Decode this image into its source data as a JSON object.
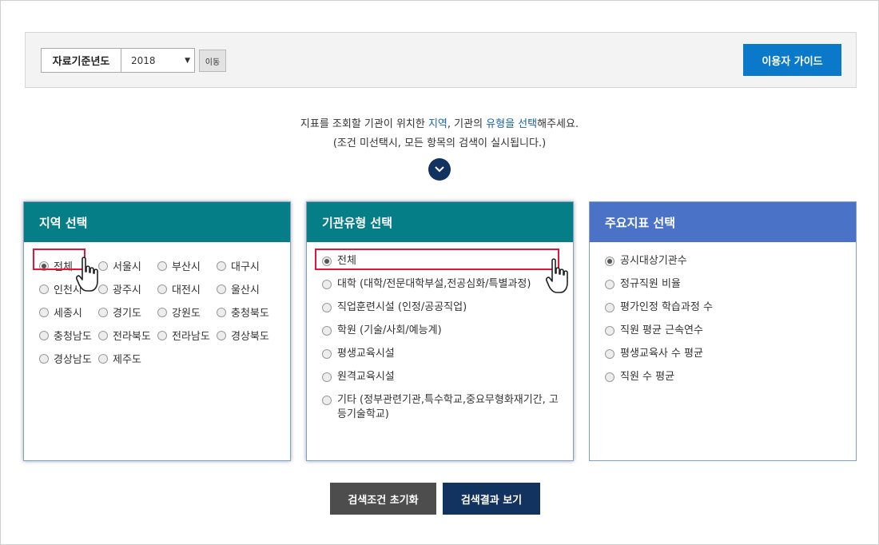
{
  "filter_bar": {
    "year_label": "자료기준년도",
    "year_value": "2018",
    "move_button": "이동",
    "guide_button": "이용자 가이드"
  },
  "instructions": {
    "line1_pre": "지표를 조회할 기관이 위치한 ",
    "line1_hl1": "지역",
    "line1_mid": ", 기관의 ",
    "line1_hl2": "유형을 선택",
    "line1_post": "해주세요.",
    "line2": "(조건 미선택시, 모든 항목의 검색이 실시됩니다.)"
  },
  "region_panel": {
    "title": "지역 선택",
    "rows": [
      [
        "전체",
        "서울시",
        "부산시",
        "대구시"
      ],
      [
        "인천시",
        "광주시",
        "대전시",
        "울산시"
      ],
      [
        "세종시",
        "경기도",
        "강원도",
        "충청북도"
      ],
      [
        "충청남도",
        "전라북도",
        "전라남도",
        "경상북도"
      ],
      [
        "경상남도",
        "제주도"
      ]
    ],
    "selected": "전체"
  },
  "type_panel": {
    "title": "기관유형 선택",
    "items": [
      "전체",
      "대학 (대학/전문대학부설,전공심화/특별과정)",
      "직업훈련시설 (인정/공공직업)",
      "학원 (기술/사회/예능계)",
      "평생교육시설",
      "원격교육시설",
      "기타 (정부관련기관,특수학교,중요무형화재기간, 고등기술학교)"
    ],
    "selected": "전체"
  },
  "indicator_panel": {
    "title": "주요지표 선택",
    "items": [
      "공시대상기관수",
      "정규직원 비율",
      "평가인정 학습과정 수",
      "직원 평균 근속연수",
      "평생교육사 수 평균",
      "직원 수 평균"
    ],
    "selected": "공시대상기관수"
  },
  "buttons": {
    "reset": "검색조건 초기화",
    "search": "검색결과 보기"
  },
  "colors": {
    "accent_blue": "#0b79c9",
    "navy": "#12335f",
    "teal": "#067e87",
    "indicator_blue": "#4a72c7",
    "highlight_red": "#e0173b"
  }
}
